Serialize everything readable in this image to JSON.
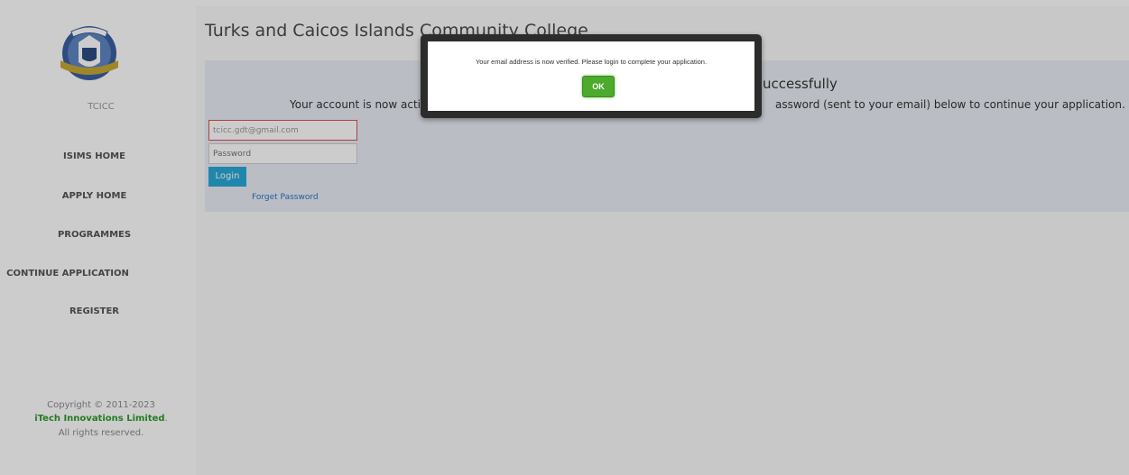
{
  "sidebar": {
    "org_abbr": "TCICC",
    "items": [
      {
        "label": "ISIMS HOME"
      },
      {
        "label": "APPLY HOME"
      },
      {
        "label": "PROGRAMMES"
      },
      {
        "label": "CONTINUE APPLICATION"
      },
      {
        "label": "REGISTER"
      }
    ],
    "footer": {
      "copyright": "Copyright © 2011-2023",
      "company": "iTech Innovations Limited",
      "period": ".",
      "rights": "All rights reserved."
    }
  },
  "header": {
    "title": "Turks and Caicos Islands Community College"
  },
  "panel": {
    "heading_visible": "uccessfully",
    "text_left_visible": "Your account is now activ",
    "text_right_visible": "assword (sent to your email) below to continue your application."
  },
  "login": {
    "email_value": "tcicc.gdt@gmail.com",
    "password_placeholder": "Password",
    "login_label": "Login",
    "forget_label": "Forget Password"
  },
  "modal": {
    "message": "Your email address is now verified. Please login to complete your application.",
    "ok_label": "OK"
  },
  "colors": {
    "accent_green": "#4caa2c",
    "login_blue": "#2aa8d8",
    "error_red": "#d9534f",
    "brand_green": "#2f9a2f"
  }
}
